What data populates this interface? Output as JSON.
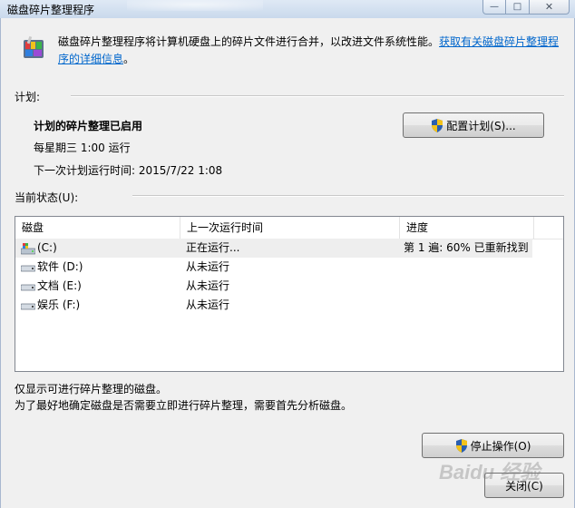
{
  "window": {
    "title": "磁盘碎片整理程序",
    "buttons": {
      "minimize": "—",
      "maximize": "□",
      "close": "✕"
    }
  },
  "intro": {
    "text": "磁盘碎片整理程序将计算机硬盘上的碎片文件进行合并，以改进文件系统性能。",
    "link": "获取有关磁盘碎片整理程序的详细信息",
    "suffix": "。"
  },
  "schedule": {
    "group_label": "计划:",
    "status": "计划的碎片整理已启用",
    "frequency": "每星期三  1:00 运行",
    "next_run": "下一次计划运行时间: 2015/7/22 1:08",
    "configure_button": "配置计划(S)..."
  },
  "current_status": {
    "group_label": "当前状态(U):",
    "columns": [
      "磁盘",
      "上一次运行时间",
      "进度"
    ],
    "rows": [
      {
        "disk": "(C:)",
        "last_run": "正在运行...",
        "progress": "第 1 遍: 60% 已重新找到",
        "icon": "system-drive-icon",
        "selected": true
      },
      {
        "disk": "软件 (D:)",
        "last_run": "从未运行",
        "progress": "",
        "icon": "drive-icon"
      },
      {
        "disk": "文档 (E:)",
        "last_run": "从未运行",
        "progress": "",
        "icon": "drive-icon"
      },
      {
        "disk": "娱乐 (F:)",
        "last_run": "从未运行",
        "progress": "",
        "icon": "drive-icon"
      }
    ]
  },
  "notes": {
    "line1": "仅显示可进行碎片整理的磁盘。",
    "line2": "为了最好地确定磁盘是否需要立即进行碎片整理，需要首先分析磁盘。"
  },
  "actions": {
    "stop_button": "停止操作(O)",
    "close_button": "关闭(C)"
  },
  "watermark": "Baidu 经验"
}
